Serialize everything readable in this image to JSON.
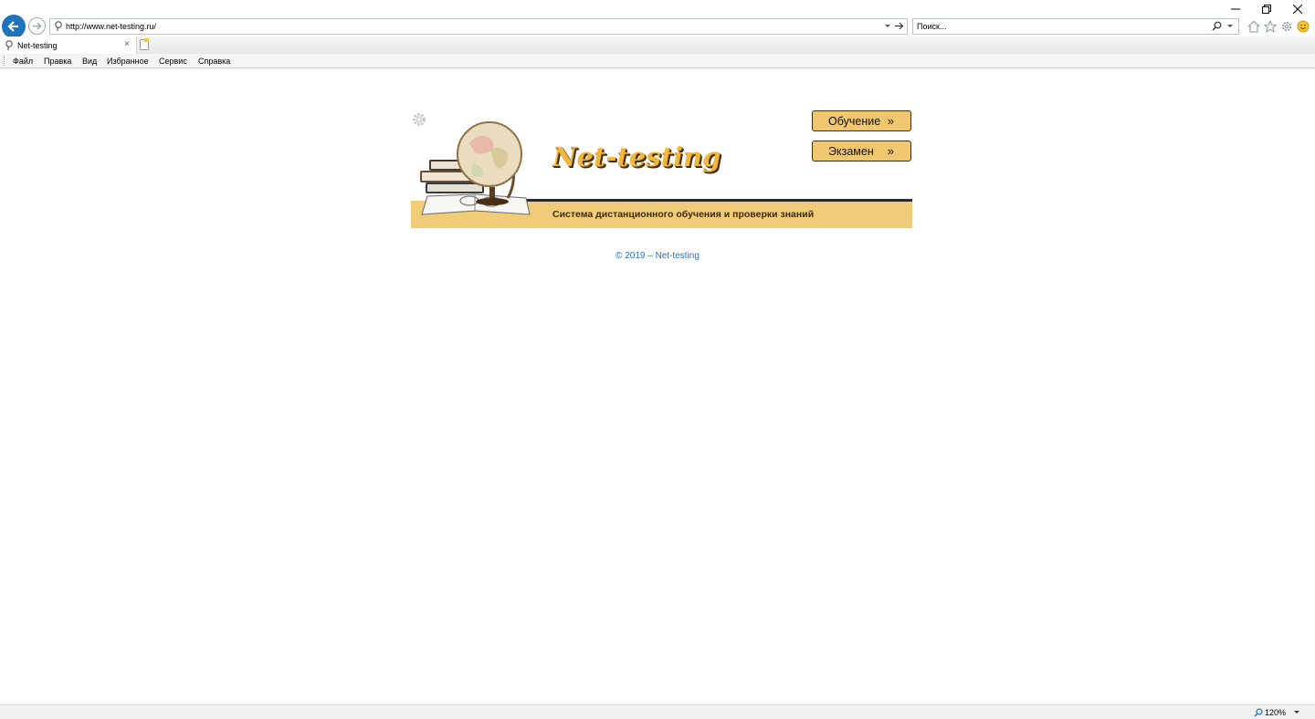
{
  "browser": {
    "url": "http://www.net-testing.ru/",
    "search_placeholder": "Поиск...",
    "tab_title": "Net-testing",
    "tab_close": "×",
    "menu": [
      "Файл",
      "Правка",
      "Вид",
      "Избранное",
      "Сервис",
      "Справка"
    ],
    "zoom": "120%"
  },
  "page": {
    "logo_text": "Net-testing",
    "tagline": "Система дистанционного обучения и проверки знаний",
    "buttons": [
      {
        "label": "Обучение",
        "arrow": "»"
      },
      {
        "label": "Экзамен",
        "arrow": "»"
      }
    ],
    "footer": "© 2019 – Net-testing"
  },
  "colors": {
    "accent": "#f0c66e",
    "band": "#f0cc78",
    "link": "#2b6fb5",
    "back_button": "#1e73be"
  }
}
